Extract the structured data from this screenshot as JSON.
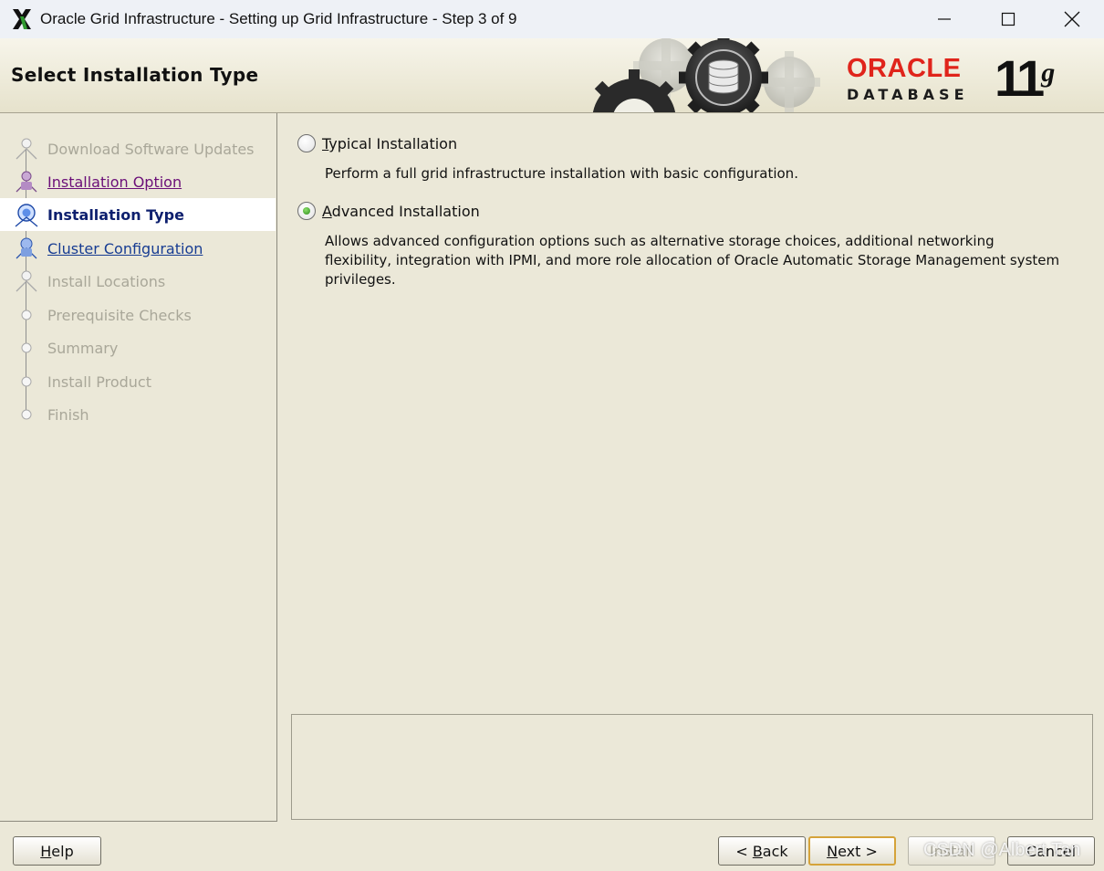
{
  "window": {
    "title": "Oracle Grid Infrastructure - Setting up Grid Infrastructure - Step 3 of 9",
    "controls": [
      "minimize-icon",
      "maximize-icon",
      "close-icon"
    ]
  },
  "banner": {
    "title": "Select Installation Type",
    "logo_oracle": "ORACLE",
    "logo_database": "DATABASE",
    "logo_version": "11",
    "logo_version_suffix": "g"
  },
  "steps": [
    {
      "label": "Download Software Updates",
      "state": "disabled"
    },
    {
      "label": "Installation Option",
      "state": "done"
    },
    {
      "label": "Installation Type",
      "state": "current"
    },
    {
      "label": "Cluster Configuration",
      "state": "link"
    },
    {
      "label": "Install Locations",
      "state": "disabled"
    },
    {
      "label": "Prerequisite Checks",
      "state": "disabled"
    },
    {
      "label": "Summary",
      "state": "disabled"
    },
    {
      "label": "Install Product",
      "state": "disabled"
    },
    {
      "label": "Finish",
      "state": "disabled"
    }
  ],
  "options": {
    "typical": {
      "label_mnemonic": "T",
      "label_rest": "ypical Installation",
      "description": "Perform a full grid infrastructure installation with basic configuration.",
      "selected": false
    },
    "advanced": {
      "label_mnemonic": "A",
      "label_rest": "dvanced Installation",
      "description": "Allows advanced configuration options such as alternative storage choices, additional networking flexibility, integration with IPMI, and more role allocation of Oracle Automatic Storage Management system privileges.",
      "selected": true
    }
  },
  "buttons": {
    "help_mnemonic": "H",
    "help_rest": "elp",
    "back_prefix": "< ",
    "back_mnemonic": "B",
    "back_rest": "ack",
    "next_mnemonic": "N",
    "next_rest": "ext >",
    "install_label": "Install",
    "cancel_label": "Cancel"
  },
  "watermark": "CSDN @Albert Tan",
  "colors": {
    "background": "#ebe8d8",
    "oracle_red": "#e0241b",
    "step_done": "#6b0f78",
    "step_current": "#0d1f6e",
    "step_link": "#173c92",
    "step_disabled": "#a9a799",
    "default_button_border": "#d5a33a"
  }
}
